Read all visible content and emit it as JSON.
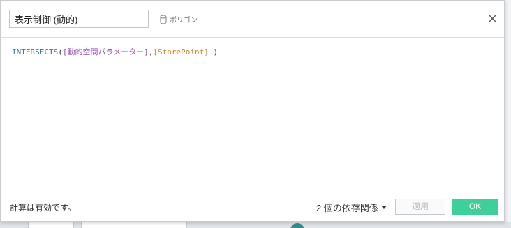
{
  "dialog": {
    "name_value": "表示制御 (動的)",
    "datasource_icon": "database-icon",
    "datasource_label": "ポリゴン",
    "close_icon": "close-icon"
  },
  "formula": {
    "function": "INTERSECTS",
    "open_paren": "(",
    "param1": "[動的空間パラメーター]",
    "comma": ",",
    "param2": "[StorePoint]",
    "close_paren": " )"
  },
  "footer": {
    "status": "計算は有効です。",
    "dependencies_label": "2 個の依存関係",
    "apply_label": "適用",
    "ok_label": "OK"
  },
  "colors": {
    "function": "#3b6fb6",
    "parameter": "#9a4dbb",
    "field": "#e0842a",
    "ok_button": "#3ecf9a"
  }
}
